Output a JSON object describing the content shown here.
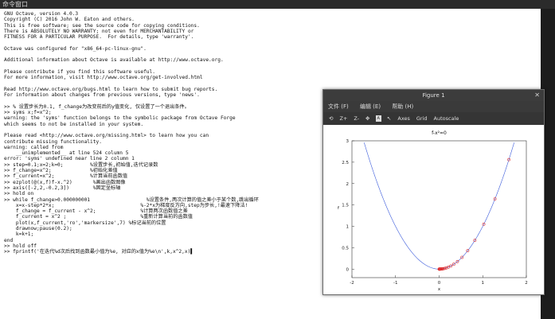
{
  "window": {
    "title": "命令窗口"
  },
  "console": {
    "lines": [
      "GNU Octave, version 4.0.3",
      "Copyright (C) 2016 John W. Eaton and others.",
      "This is free software; see the source code for copying conditions.",
      "There is ABSOLUTELY NO WARRANTY; not even for MERCHANTABILITY or",
      "FITNESS FOR A PARTICULAR PURPOSE.  For details, type 'warranty'.",
      "",
      "Octave was configured for \"x86_64-pc-linux-gnu\".",
      "",
      "Additional information about Octave is available at http://www.octave.org.",
      "",
      "Please contribute if you find this software useful.",
      "For more information, visit http://www.octave.org/get-involved.html",
      "",
      "Read http://www.octave.org/bugs.html to learn how to submit bug reports.",
      "For information about changes from previous versions, type 'news'.",
      "",
      ">> % 设置步长为0.1, f_change为改变前后的y值变化, 仅设置了一个退出条件。",
      ">> syms x;f=x^2;",
      "warning: the 'syms' function belongs to the symbolic package from Octave Forge",
      "which seems to not be installed in your system.",
      "",
      "Please read <http://www.octave.org/missing.html> to learn how you can",
      "contribute missing functionality.",
      "warning: called from",
      "    __unimplemented__ at line 524 column 5",
      "error: 'syms' undefined near line 2 column 1",
      ">> step=0.1;x=2;k=0;         %设置步长,初始值,迭代记录数",
      ">> f_change=x^2;             %初始化差值",
      ">> f_current=x^2;            %计算当前函数值",
      ">> ezplot(@(x,f)f-x.^2)       %画出函数图像",
      ">> axis([-2,2,-0.2,3])        %固定坐标轴",
      ">> hold on",
      ">> while f_change>0.000000001                   %设置条件,两次计算的值之差小于某个数,跳出循环",
      "    x=x-step*2*x;                             %-2*x为梯度反方向,step为步长,!最速下降法!",
      "    f_change = f_current - x^2;               %计算两次函数值之差",
      "    f_current = x^2 ;                         %重新计算当前的函数值",
      "    plot(x,f_current,'ro','markersize',7) %标记当前的位置",
      "    drawnow;pause(0.2);",
      "    k=k+1;",
      "end",
      ">> hold off",
      ">> fprintf('在迭代%d次后找到函数最小值为%e, 对应的x值为%e\\n',k,x^2,x)▌"
    ]
  },
  "figure": {
    "title": "Figure 1",
    "close_icon": "close-icon",
    "menu": [
      "文件 (F)",
      "编辑 (E)",
      "帮助 (H)"
    ],
    "toolbar": {
      "rotate_icon": "rotate-icon",
      "zoom_in": "Z+",
      "zoom_out": "Z-",
      "pan_icon": "pan-icon",
      "text_icon": "text-icon",
      "pointer_icon": "pointer-icon",
      "axes": "Axes",
      "grid": "Grid",
      "autoscale": "Autoscale"
    },
    "plot": {
      "title": "f-x²=0",
      "xlabel": "x",
      "ylabel": "f"
    }
  },
  "chart_data": {
    "type": "line",
    "title": "f-x²=0",
    "xlabel": "x",
    "ylabel": "f",
    "xlim": [
      -2,
      2
    ],
    "ylim": [
      -0.2,
      3
    ],
    "x_ticks": [
      -2,
      -1,
      0,
      1,
      2
    ],
    "y_ticks": [
      0,
      0.5,
      1,
      1.5,
      2,
      2.5,
      3
    ],
    "grid": false,
    "series": [
      {
        "function": "f = x^2",
        "color": "#3b5bdb",
        "style": "line"
      },
      {
        "color": "#e03131",
        "style": "markers",
        "marker": "circle",
        "x": [
          1.6,
          1.28,
          1.024,
          0.8192,
          0.65536,
          0.524288,
          0.4194,
          0.3355,
          0.2684,
          0.2147,
          0.1718,
          0.1374,
          0.11,
          0.088,
          0.0704,
          0.0563,
          0.045,
          0.036,
          0.0288,
          0.0231,
          0.0184,
          0.0148,
          0.0118,
          0.0094,
          0.0076,
          0.006,
          0.0048,
          0.0039,
          0.0031,
          0.0025
        ]
      }
    ]
  },
  "colors": {
    "curve": "#3b5bdb",
    "marker": "#e03131",
    "axis": "#333333"
  }
}
